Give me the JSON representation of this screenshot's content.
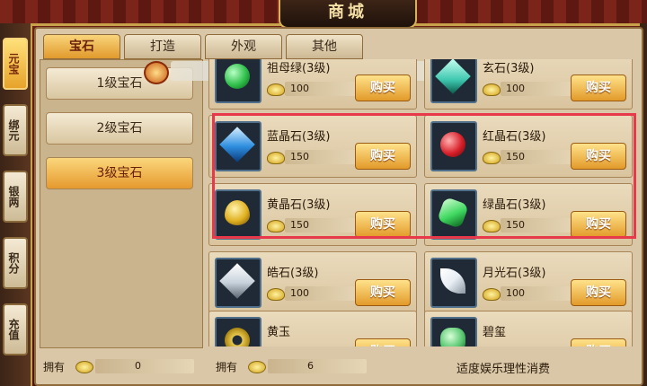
{
  "title": "商城",
  "side_tabs": [
    {
      "label": "元宝",
      "active": true
    },
    {
      "label": "绑元",
      "active": false
    },
    {
      "label": "银两",
      "active": false
    },
    {
      "label": "积分",
      "active": false
    },
    {
      "label": "充值",
      "active": false
    }
  ],
  "top_tabs": [
    {
      "label": "宝石",
      "active": true
    },
    {
      "label": "打造",
      "active": false
    },
    {
      "label": "外观",
      "active": false
    },
    {
      "label": "其他",
      "active": false
    }
  ],
  "categories": [
    {
      "label": "1级宝石",
      "active": false
    },
    {
      "label": "2级宝石",
      "active": false
    },
    {
      "label": "3级宝石",
      "active": true
    }
  ],
  "buy_label": "购买",
  "items": [
    {
      "name": "祖母绿(3级)",
      "price": "100",
      "gem_color": "#2fbf4a"
    },
    {
      "name": "玄石(3级)",
      "price": "100",
      "gem_color": "#3fc8b0"
    },
    {
      "name": "蓝晶石(3级)",
      "price": "150",
      "gem_color": "#2f8fe0"
    },
    {
      "name": "红晶石(3级)",
      "price": "150",
      "gem_color": "#d8202a"
    },
    {
      "name": "黄晶石(3级)",
      "price": "150",
      "gem_color": "#e0b020"
    },
    {
      "name": "绿晶石(3级)",
      "price": "150",
      "gem_color": "#3fd860"
    },
    {
      "name": "皓石(3级)",
      "price": "100",
      "gem_color": "#c8d2dc"
    },
    {
      "name": "月光石(3级)",
      "price": "100",
      "gem_color": "#e8eef4"
    },
    {
      "name": "黄玉",
      "price": "",
      "gem_color": "#e8c850"
    },
    {
      "name": "碧玺",
      "price": "",
      "gem_color": "#58c870"
    }
  ],
  "footer": {
    "own_label_1": "拥有",
    "own_value_1": "0",
    "own_label_2": "拥有",
    "own_value_2": "6",
    "notice": "适度娱乐理性消费"
  }
}
